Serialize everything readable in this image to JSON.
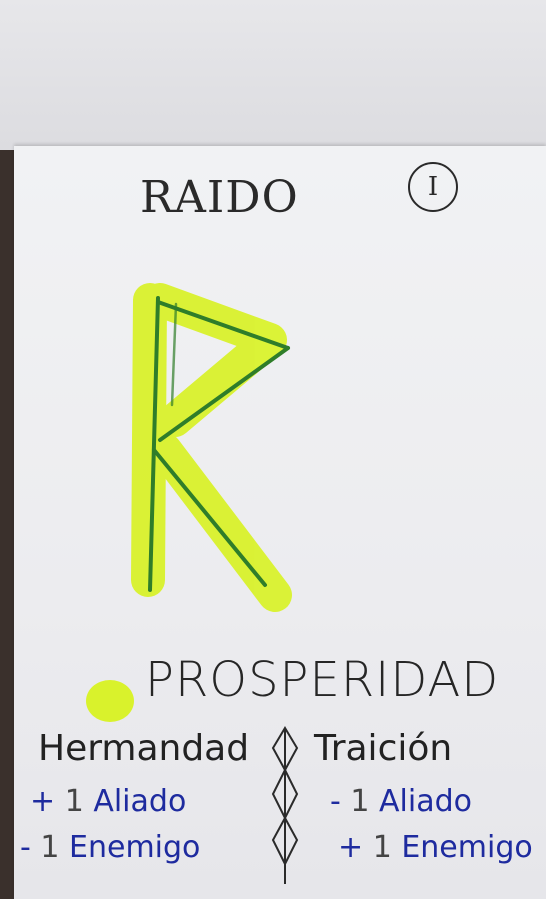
{
  "card": {
    "title": "RAIDO",
    "numeral": "I",
    "meaning": "PROSPERIDAD",
    "left_column": {
      "heading": "Hermandad",
      "rows": [
        {
          "sign": "+",
          "num": "1",
          "text": "Aliado"
        },
        {
          "sign": "-",
          "num": "1",
          "text": "Enemigo"
        }
      ]
    },
    "right_column": {
      "heading": "Traición",
      "rows": [
        {
          "sign": "-",
          "num": "1",
          "text": "Aliado"
        },
        {
          "sign": "+",
          "num": "1",
          "text": "Enemigo"
        }
      ]
    },
    "colors": {
      "highlight": "#d9f22c",
      "rune_line": "#2f7d2a",
      "ink": "#2a2a2a",
      "blue_ink": "#1e2b9f"
    }
  }
}
